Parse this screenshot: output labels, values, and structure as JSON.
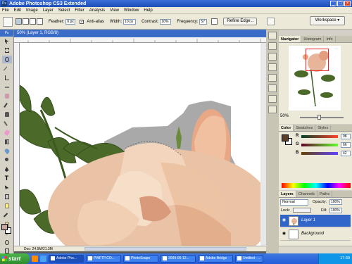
{
  "app": {
    "title": "Adobe Photoshop CS3 Extended",
    "logo": "Ps"
  },
  "menu": [
    "File",
    "Edit",
    "Image",
    "Layer",
    "Select",
    "Filter",
    "Analysis",
    "View",
    "Window",
    "Help"
  ],
  "options": {
    "feather_label": "Feather:",
    "feather_value": "0 px",
    "antialias_label": "Anti-alias",
    "width_label": "Width:",
    "width_value": "10 px",
    "contrast_label": "Contrast:",
    "contrast_value": "10%",
    "frequency_label": "Frequency:",
    "frequency_value": "57",
    "refine_edge": "Refine Edge...",
    "workspace": "Workspace ▾"
  },
  "document": {
    "tab_title": "50% (Layer 1, RGB/8)",
    "status": "Doc: 24.9M/21.3M"
  },
  "navigator": {
    "tabs": [
      "Navigator",
      "Histogram",
      "Info"
    ],
    "zoom": "50%"
  },
  "color_panel": {
    "tabs": [
      "Color",
      "Swatches",
      "Styles"
    ],
    "r_label": "R",
    "g_label": "G",
    "b_label": "B",
    "r": "98",
    "g": "66",
    "b": "42",
    "fg_color": "#5a3e2a"
  },
  "layers_panel": {
    "tabs": [
      "Layers",
      "Channels",
      "Paths"
    ],
    "blend_mode": "Normal",
    "opacity_label": "Opacity:",
    "opacity": "100%",
    "lock_label": "Lock:",
    "fill_label": "Fill:",
    "fill": "100%",
    "layers": [
      "Layer 1",
      "Background"
    ]
  },
  "taskbar": {
    "start": "start",
    "tasks": [
      "Adobe Pho...",
      "PWFTP.CO...",
      "PhotoScape",
      "2009-05-12...",
      "Adobe Bridge",
      "Untitled - ..."
    ],
    "clock": "17:39"
  },
  "colors": {
    "titlebar": "#245edb",
    "selected_layer": "#3165c8",
    "doc_tab": "#3a6cc8"
  }
}
